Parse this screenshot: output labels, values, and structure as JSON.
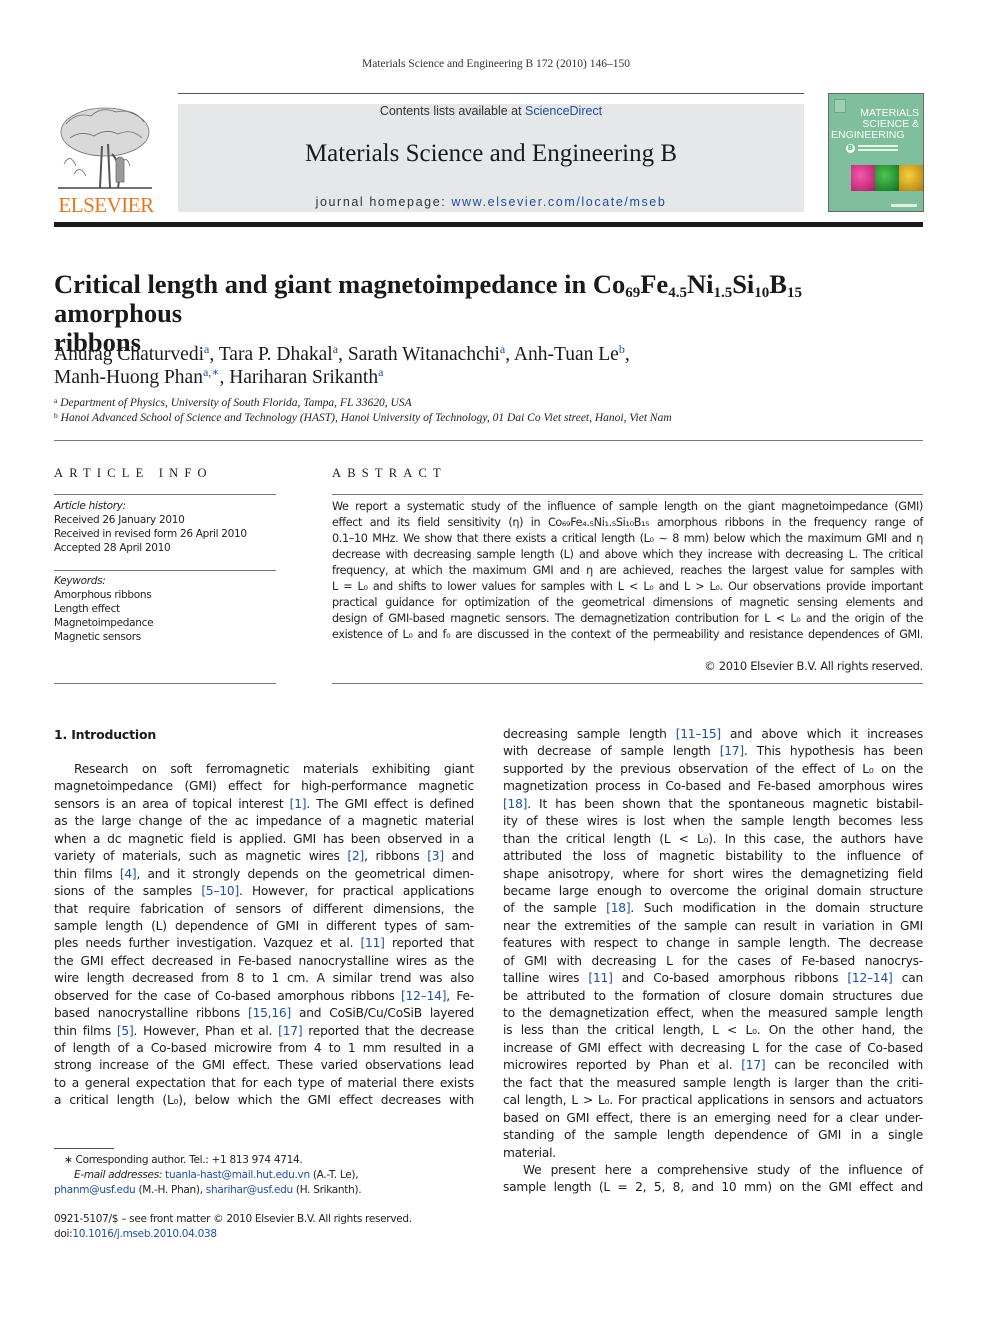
{
  "running_head": "Materials Science and Engineering B 172 (2010) 146–150",
  "publisher": {
    "logo_word": "ELSEVIER",
    "brand_color": "#e87722"
  },
  "journal_banner": {
    "contents_prefix": "Contents lists available at ",
    "contents_link": "ScienceDirect",
    "journal_title": "Materials Science and Engineering B",
    "homepage_prefix": "journal homepage: ",
    "homepage_link": "www.elsevier.com/locate/mseb",
    "link_color": "#1f4fa0"
  },
  "cover": {
    "line1": "MATERIALS",
    "line2": "SCIENCE &",
    "line3": "ENGINEERING",
    "badge": "B"
  },
  "article": {
    "title_parts": [
      "Critical length and giant magnetoimpedance in Co",
      "69",
      "Fe",
      "4.5",
      "Ni",
      "1.5",
      "Si",
      "10",
      "B",
      "15",
      " amorphous",
      "ribbons"
    ],
    "authors": [
      {
        "name": "Anurag Chaturvedi",
        "aff": "a"
      },
      {
        "name": "Tara P. Dhakal",
        "aff": "a"
      },
      {
        "name": "Sarath Witanachchi",
        "aff": "a"
      },
      {
        "name": "Anh-Tuan Le",
        "aff": "b"
      },
      {
        "name": "Manh-Huong Phan",
        "aff": "a,∗"
      },
      {
        "name": "Hariharan Srikanth",
        "aff": "a"
      }
    ],
    "affiliations": [
      {
        "mark": "a",
        "text": "Department of Physics, University of South Florida, Tampa, FL 33620, USA"
      },
      {
        "mark": "b",
        "text": "Hanoi Advanced School of Science and Technology (HAST), Hanoi University of Technology, 01 Dai Co Viet street, Hanoi, Viet Nam"
      }
    ]
  },
  "article_info": {
    "heading": "ARTICLE INFO",
    "history_label": "Article history:",
    "history": [
      "Received 26 January 2010",
      "Received in revised form 26 April 2010",
      "Accepted 28 April 2010"
    ],
    "keywords_label": "Keywords:",
    "keywords": [
      "Amorphous ribbons",
      "Length effect",
      "Magnetoimpedance",
      "Magnetic sensors"
    ]
  },
  "abstract": {
    "heading": "ABSTRACT",
    "lines": [
      "We report a systematic study of the influence of sample length on the giant magnetoimpedance (GMI)",
      "effect and its field sensitivity (η) in Co₆₉Fe₄.₅Ni₁.₅Si₁₀B₁₅ amorphous ribbons in the frequency range of",
      "0.1–10 MHz. We show that there exists a critical length (L₀ ∼ 8 mm) below which the maximum GMI and η",
      "decrease with decreasing sample length (L) and above which they increase with decreasing L. The critical",
      "frequency, at which the maximum GMI and η are achieved, reaches the largest value for samples with",
      "L = L₀ and shifts to lower values for samples with L < L₀ and L > L₀. Our observations provide important",
      "practical guidance for optimization of the geometrical dimensions of magnetic sensing elements and",
      "design of GMI-based magnetic sensors. The demagnetization contribution for L < L₀ and the origin of the",
      "existence of L₀ and f₀ are discussed in the context of the permeability and resistance dependences of GMI."
    ],
    "copyright": "© 2010 Elsevier B.V. All rights reserved."
  },
  "body": {
    "section_heading": "1.  Introduction",
    "left_column_lines": [
      "Research on soft ferromagnetic materials exhibiting giant",
      "magnetoimpedance (GMI) effect for high-performance magnetic",
      "sensors is an area of topical interest [1]. The GMI effect is defined",
      "as the large change of the ac impedance of a magnetic material",
      "when a dc magnetic field is applied. GMI has been observed in a",
      "variety of materials, such as magnetic wires [2], ribbons [3] and",
      "thin films [4], and it strongly depends on the geometrical dimen-",
      "sions of the samples [5–10]. However, for practical applications",
      "that require fabrication of sensors of different dimensions, the",
      "sample length (L) dependence of GMI in different types of sam-",
      "ples needs further investigation. Vazquez et al. [11] reported that",
      "the GMI effect decreased in Fe-based nanocrystalline wires as the",
      "wire length decreased from 8 to 1 cm. A similar trend was also",
      "observed for the case of Co-based amorphous ribbons [12–14], Fe-",
      "based nanocrystalline ribbons [15,16] and CoSiB/Cu/CoSiB layered",
      "thin films [5]. However, Phan et al. [17] reported that the decrease",
      "of length of a Co-based microwire from 4 to 1 mm resulted in a",
      "strong increase of the GMI effect. These varied observations lead",
      "to a general expectation that for each type of material there exists",
      "a critical length (L₀), below which the GMI effect decreases with"
    ],
    "right_column_lines": [
      "decreasing sample length [11–15] and above which it increases",
      "with decrease of sample length [17]. This hypothesis has been",
      "supported by the previous observation of the effect of L₀ on the",
      "magnetization process in Co-based and Fe-based amorphous wires",
      "[18]. It has been shown that the spontaneous magnetic bistabil-",
      "ity of these wires is lost when the sample length becomes less",
      "than the critical length (L < L₀). In this case, the authors have",
      "attributed the loss of magnetic bistability to the influence of",
      "shape anisotropy, where for short wires the demagnetizing field",
      "became large enough to overcome the original domain structure",
      "of the sample [18]. Such modification in the domain structure",
      "near the extremities of the sample can result in variation in GMI",
      "features with respect to change in sample length. The decrease",
      "of GMI with decreasing L for the cases of Fe-based nanocrys-",
      "talline wires [11] and Co-based amorphous ribbons [12–14] can",
      "be attributed to the formation of closure domain structures due",
      "to the demagnetization effect, when the measured sample length",
      "is less than the critical length, L < L₀. On the other hand, the",
      "increase of GMI effect with decreasing L for the case of Co-based",
      "microwires reported by Phan et al. [17] can be reconciled with",
      "the fact that the measured sample length is larger than the criti-",
      "cal length, L > L₀. For practical applications in sensors and actuators",
      "based on GMI effect, there is an emerging need for a clear under-",
      "standing of the sample length dependence of GMI in a single",
      "material.",
      "We present here a comprehensive study of the influence of",
      "sample length (L = 2, 5, 8, and 10 mm) on the GMI effect and"
    ]
  },
  "footnotes": {
    "corresponding": "∗  Corresponding author. Tel.: +1 813 974 4714.",
    "email_label": "E-mail addresses:",
    "emails": [
      {
        "address": "tuanla-hast@mail.hut.edu.vn",
        "owner": "(A.-T. Le),"
      },
      {
        "address": "phanm@usf.edu",
        "owner": "(M.-H. Phan),"
      },
      {
        "address": "sharihar@usf.edu",
        "owner": "(H. Srikanth)."
      }
    ]
  },
  "front_matter": {
    "issn_line": "0921-5107/$ – see front matter © 2010 Elsevier B.V. All rights reserved.",
    "doi_prefix": "doi:",
    "doi": "10.1016/j.mseb.2010.04.038"
  }
}
